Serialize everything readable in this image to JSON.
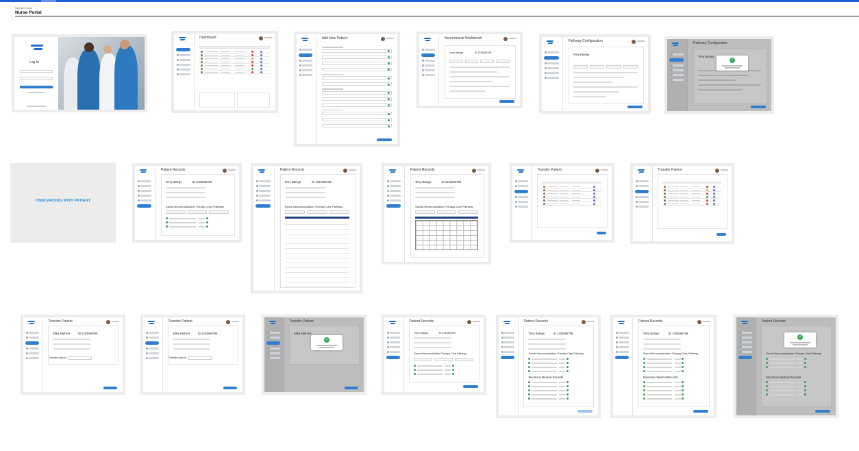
{
  "app": {
    "subtitle": "Sample Care",
    "title": "Nurse Portal"
  },
  "colors": {
    "accent": "#2f7fd1",
    "topbar": "#1f5fd6",
    "success": "#3aa55a",
    "onboarding_text": "#2a8fd8"
  },
  "screens": {
    "login": {
      "title": "Log In"
    },
    "dashboard": {
      "title": "Dashboard"
    },
    "add_patient": {
      "title": "Add New Patient"
    },
    "neuro": {
      "title": "Neuroclinical Workbench",
      "patient_name": "Terry Batege",
      "patient_id": "ID 1234566789"
    },
    "pathway": {
      "title": "Pathway Configuration",
      "patient_name": "Terry Batege",
      "patient_id": "ID 1234566789"
    },
    "pathway_modal": {
      "title": "Pathway Configuration",
      "patient_name": "Terry Batege",
      "patient_id": "ID 1234566789"
    },
    "onboarding": {
      "label": "ONBOARDING WITH PATIENT"
    },
    "records_1": {
      "title": "Patient Records",
      "patient_name": "Terry Batege",
      "patient_id": "ID 1234566789",
      "section": "Sacral Neuromodulation Therapy Care Pathway"
    },
    "records_2": {
      "title": "Patient Records",
      "patient_name": "Terry Batege",
      "patient_id": "ID 1234566789",
      "section": "Sacral Neuromodulation Therapy Care Pathway"
    },
    "records_3": {
      "title": "Patient Records",
      "patient_name": "Terry Batege",
      "patient_id": "ID 1234566789",
      "section": "Sacral Neuromodulation Therapy Care Pathway"
    },
    "transfer_1": {
      "title": "Transfer Patient"
    },
    "transfer_2": {
      "title": "Transfer Patient"
    },
    "transfer_3": {
      "title": "Transfer Patient",
      "patient_name": "Mika Mathers",
      "patient_id": "ID 1234566789",
      "transfer_label": "Transfer care to"
    },
    "transfer_4": {
      "title": "Transfer Patient",
      "patient_name": "Mika Mathers",
      "patient_id": "ID 1234566789",
      "transfer_label": "Transfer care to"
    },
    "transfer_5": {
      "title": "Transfer Patient",
      "patient_name": "Mika Mathers"
    },
    "records_4": {
      "title": "Patient Records",
      "patient_name": "Terry Batege",
      "patient_id": "ID 1234566789",
      "section": "Sacral Neuromodulation Therapy Care Pathway"
    },
    "records_5": {
      "title": "Patient Records",
      "patient_name": "Terry Batege",
      "patient_id": "ID 1234566789",
      "section": "Sacral Neuromodulation Therapy Care Pathway",
      "section2": "Electronic Medical Records"
    },
    "records_6": {
      "title": "Patient Records",
      "patient_name": "Terry Batege",
      "patient_id": "ID 1234566789",
      "section": "Sacral Neuromodulation Therapy Care Pathway",
      "section2": "Electronic Medical Records"
    },
    "records_7": {
      "title": "Patient Records",
      "section": "Sacral Neuromodulation Therapy Care Pathway",
      "section2": "Electronic Medical Records"
    }
  }
}
